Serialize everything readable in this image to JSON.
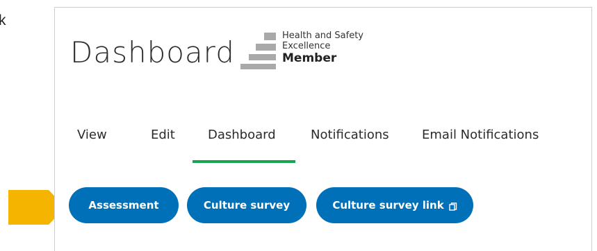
{
  "left_text": "k",
  "title": "Dashboard",
  "logo": {
    "line1": "Health and Safety",
    "line2": "Excellence",
    "line3": "Member"
  },
  "tabs": [
    {
      "label": "View"
    },
    {
      "label": "Edit"
    },
    {
      "label": "Dashboard"
    },
    {
      "label": "Notifications"
    },
    {
      "label": "Email Notifications"
    }
  ],
  "buttons": [
    {
      "label": "Assessment"
    },
    {
      "label": "Culture survey"
    },
    {
      "label": "Culture survey link",
      "icon": "copy-icon"
    }
  ],
  "colors": {
    "accent": "#0070b8",
    "tab_active_underline": "#1aa352",
    "arrow": "#f4b400"
  }
}
